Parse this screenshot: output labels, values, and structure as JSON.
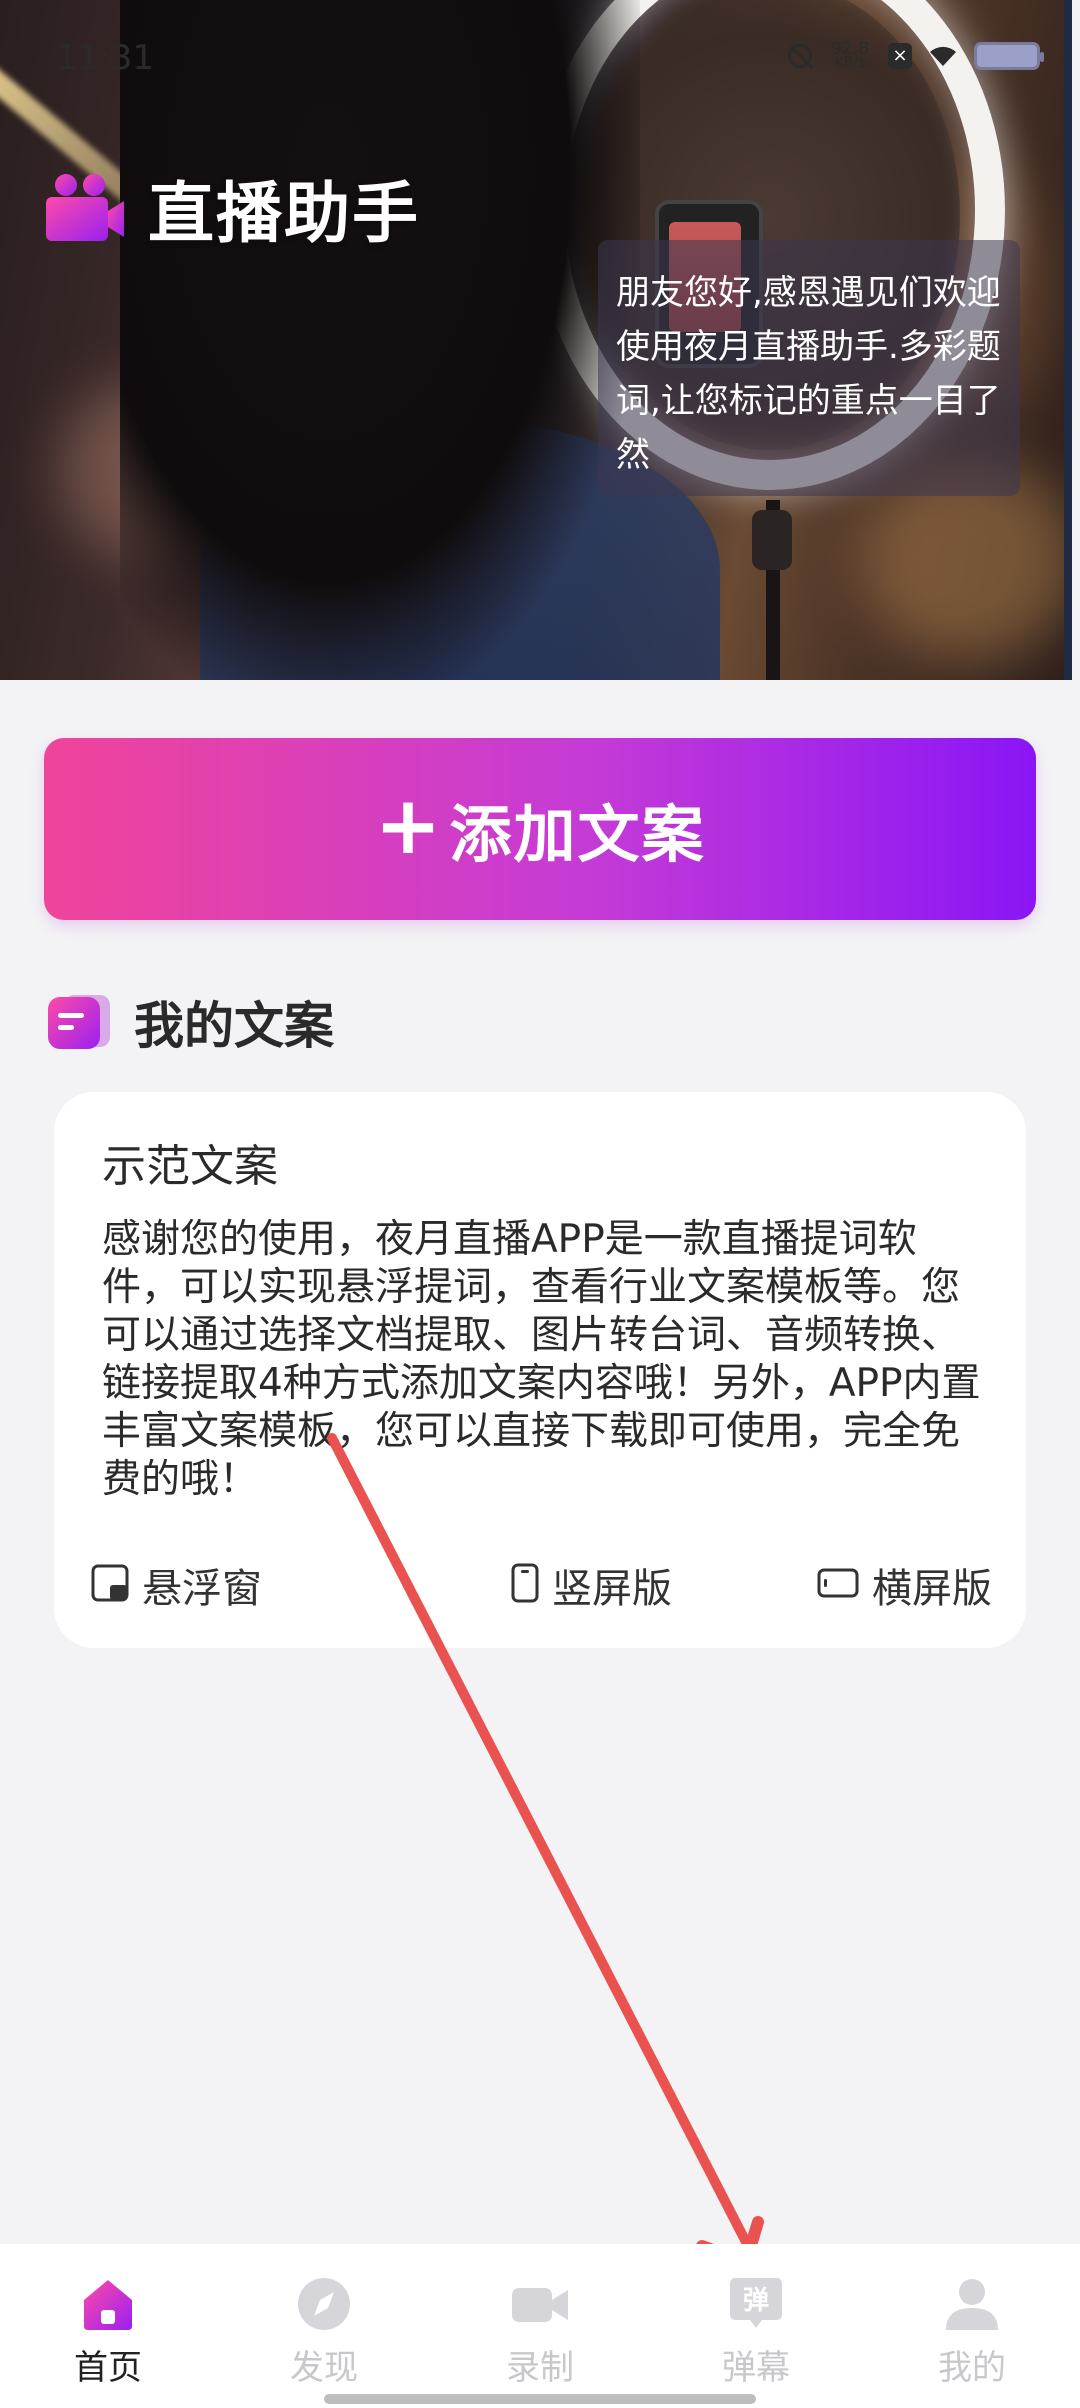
{
  "status_bar": {
    "time": "11:31",
    "net_speed_value": "92.8",
    "net_speed_unit": "KB/s"
  },
  "app": {
    "title": "直播助手"
  },
  "hero": {
    "prompter_text": "朋友您好,感恩遇见们欢迎使用夜月直播助手.多彩题词,让您标记的重点一目了然"
  },
  "add_button": {
    "plus": "+",
    "label": "添加文案"
  },
  "section": {
    "title": "我的文案"
  },
  "card": {
    "title": "示范文案",
    "body": "感谢您的使用，夜月直播APP是一款直播提词软件，可以实现悬浮提词，查看行业文案模板等。您可以通过选择文档提取、图片转台词、音频转换、链接提取4种方式添加文案内容哦！另外，APP内置丰富文案模板，您可以直接下载即可使用，完全免费的哦！",
    "actions": {
      "floating": "悬浮窗",
      "portrait": "竖屏版",
      "landscape": "横屏版"
    }
  },
  "bottom_nav": {
    "items": [
      {
        "label": "首页",
        "icon": "home-icon",
        "active": true
      },
      {
        "label": "发现",
        "icon": "compass-icon",
        "active": false
      },
      {
        "label": "录制",
        "icon": "video-camera-icon",
        "active": false
      },
      {
        "label": "弹幕",
        "icon": "danmaku-icon",
        "active": false,
        "badge_text": "弹"
      },
      {
        "label": "我的",
        "icon": "profile-icon",
        "active": false
      }
    ]
  },
  "colors": {
    "accent_pink": "#f0449a",
    "accent_purple": "#8a16f5",
    "annotation_arrow": "#e9524f"
  }
}
